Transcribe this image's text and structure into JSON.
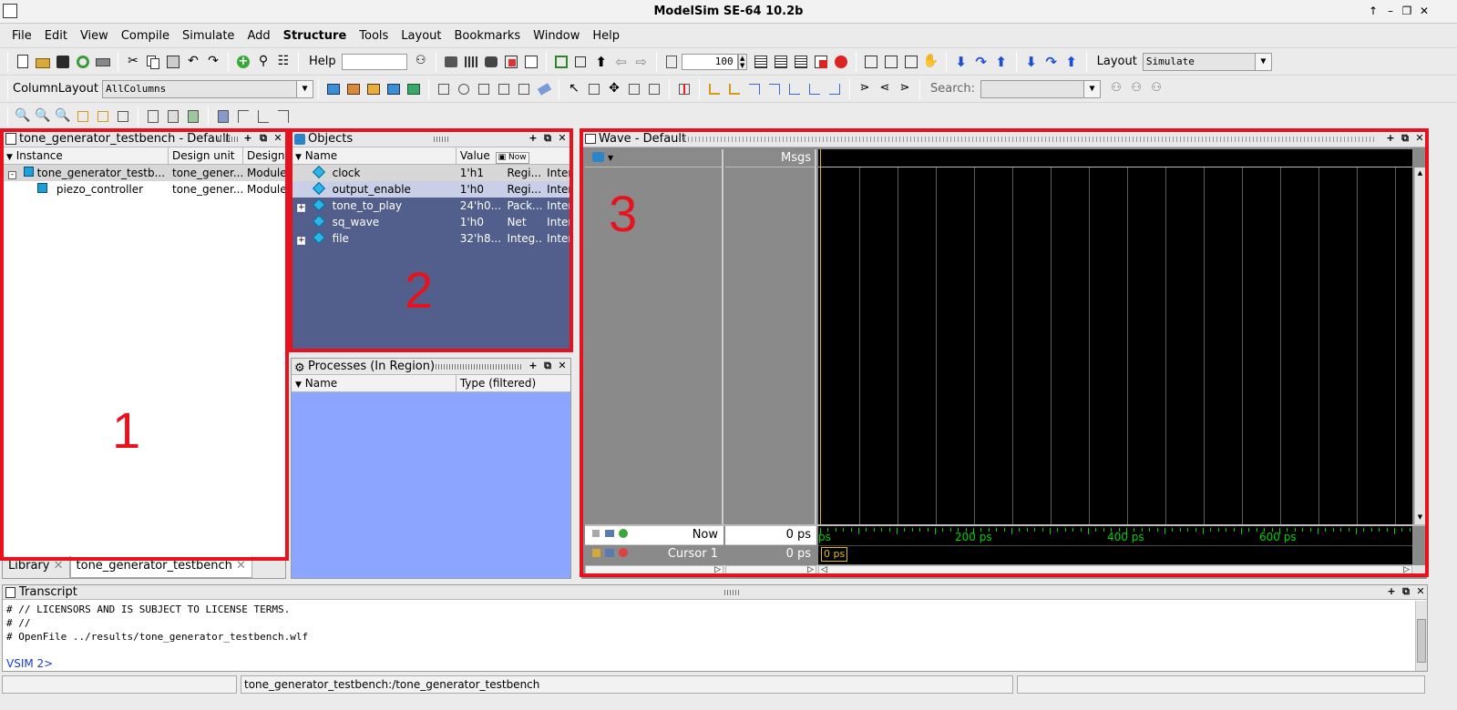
{
  "window": {
    "title": "ModelSim SE-64 10.2b"
  },
  "menu": [
    "File",
    "Edit",
    "View",
    "Compile",
    "Simulate",
    "Add",
    "Structure",
    "Tools",
    "Layout",
    "Bookmarks",
    "Window",
    "Help"
  ],
  "toolbar": {
    "help_label": "Help",
    "zoom_value": "100",
    "layout_label": "Layout",
    "layout_value": "Simulate",
    "column_layout_label": "ColumnLayout",
    "column_layout_value": "AllColumns",
    "search_label": "Search:"
  },
  "sim_panel": {
    "title": "tone_generator_testbench - Default",
    "columns": [
      "Instance",
      "Design unit",
      "Design"
    ],
    "rows": [
      {
        "instance": "tone_generator_testb...",
        "design_unit": "tone_gener...",
        "design": "Module"
      },
      {
        "instance": "piezo_controller",
        "design_unit": "tone_gener...",
        "design": "Module"
      }
    ],
    "tabs": [
      "Library",
      "tone_generator_testbench"
    ]
  },
  "objects_panel": {
    "title": "Objects",
    "columns": [
      "Name",
      "Value"
    ],
    "now_label": "Now",
    "rows": [
      {
        "name": "clock",
        "value": "1'h1",
        "kind": "Regi...",
        "mode": "Inter"
      },
      {
        "name": "output_enable",
        "value": "1'h0",
        "kind": "Regi...",
        "mode": "Inter"
      },
      {
        "name": "tone_to_play",
        "value": "24'h0...",
        "kind": "Pack...",
        "mode": "Inter"
      },
      {
        "name": "sq_wave",
        "value": "1'h0",
        "kind": "Net",
        "mode": "Inter"
      },
      {
        "name": "file",
        "value": "32'h8...",
        "kind": "Integ...",
        "mode": "Inter"
      }
    ]
  },
  "processes_panel": {
    "title": "Processes (In Region)",
    "columns": [
      "Name",
      "Type (filtered)"
    ]
  },
  "wave_panel": {
    "title": "Wave - Default",
    "msgs_label": "Msgs",
    "now_label": "Now",
    "now_value": "0 ps",
    "cursor_label": "Cursor 1",
    "cursor_value": "0 ps",
    "cursor_flag": "0 ps",
    "timeline_labels": [
      "ps",
      "200 ps",
      "400 ps",
      "600 ps"
    ]
  },
  "transcript": {
    "title": "Transcript",
    "lines": [
      "# //  LICENSORS AND IS SUBJECT TO LICENSE TERMS.",
      "# //",
      "# OpenFile ../results/tone_generator_testbench.wlf"
    ],
    "prompt": "VSIM 2>"
  },
  "status": {
    "path": "tone_generator_testbench:/tone_generator_testbench"
  },
  "annotations": [
    "1",
    "2",
    "3"
  ],
  "colors": {
    "annotation": "#e8121e",
    "objects_bg": "#525e8c",
    "processes_bg": "#8ca6ff",
    "wave_green": "#00d000",
    "cursor": "#e0c000"
  }
}
